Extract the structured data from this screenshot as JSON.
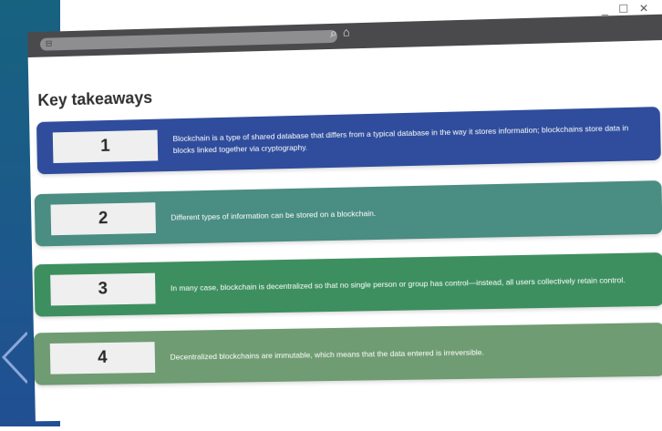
{
  "browser": {
    "window_controls": "_ ☐ ✕"
  },
  "page": {
    "title": "Key takeaways"
  },
  "takeaways": [
    {
      "number": "1",
      "text": "Blockchain is a type of shared database that differs from a typical database in the way it stores information; blockchains store data in blocks linked together via cryptography.",
      "color": "#2f4d9c"
    },
    {
      "number": "2",
      "text": "Different types of information can be stored on a blockchain.",
      "color": "#4a8d82"
    },
    {
      "number": "3",
      "text": "In many case, blockchain is decentralized so that no single person or group has control—instead, all users collectively retain control.",
      "color": "#3d8f5f"
    },
    {
      "number": "4",
      "text": "Decentralized blockchains are immutable, which means that the data entered is irreversible.",
      "color": "#6f9c72"
    }
  ],
  "icons": [
    "search-icon",
    "home-icon",
    "lock-icon"
  ]
}
